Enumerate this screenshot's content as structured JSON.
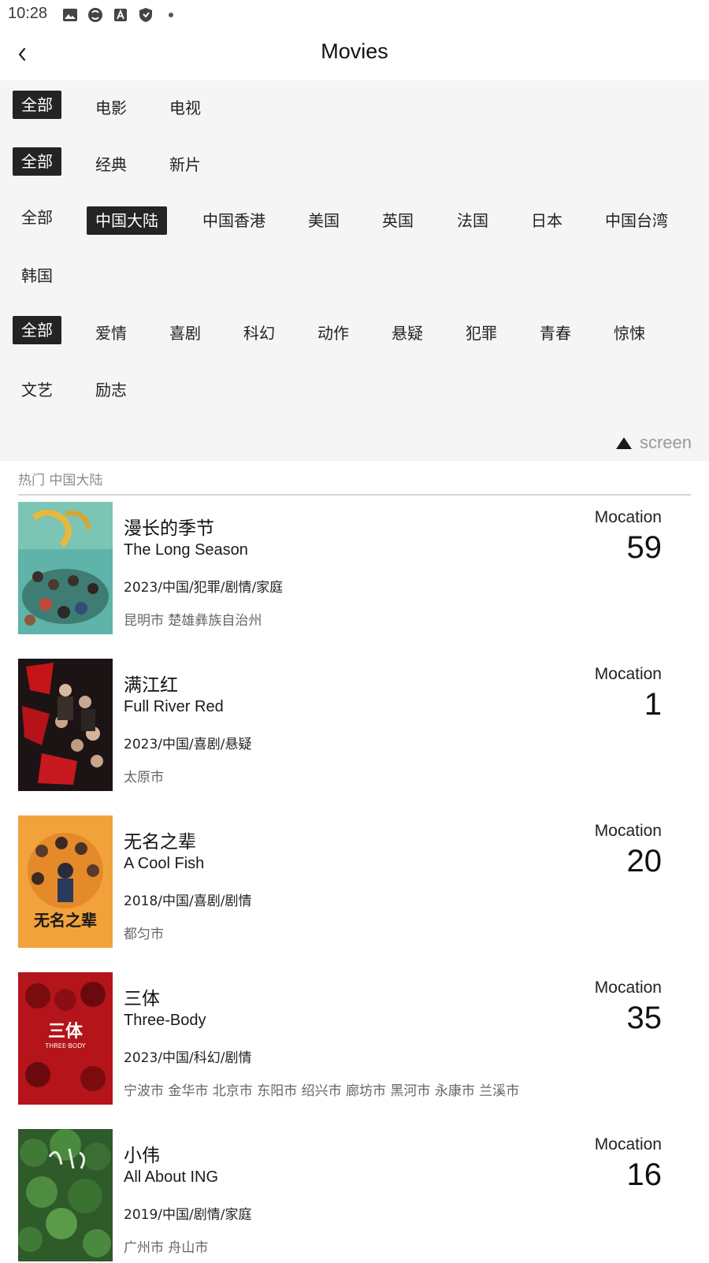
{
  "status_bar": {
    "time": "10:28"
  },
  "header": {
    "title": "Movies"
  },
  "filters": {
    "type": [
      "全部",
      "电影",
      "电视"
    ],
    "era": [
      "全部",
      "经典",
      "新片"
    ],
    "region": [
      "全部",
      "中国大陆",
      "中国香港",
      "美国",
      "英国",
      "法国",
      "日本",
      "中国台湾",
      "韩国"
    ],
    "genre": [
      "全部",
      "爱情",
      "喜剧",
      "科幻",
      "动作",
      "悬疑",
      "犯罪",
      "青春",
      "惊悚",
      "文艺",
      "励志"
    ],
    "toggle_label": "screen"
  },
  "section": {
    "label": "热门 中国大陆"
  },
  "movies": [
    {
      "title_cn": "漫长的季节",
      "title_en": "The Long Season",
      "info": "2023/中国/犯罪/剧情/家庭",
      "cities": "昆明市 楚雄彝族自治州",
      "count_label": "Mocation",
      "count": "59"
    },
    {
      "title_cn": "满江红",
      "title_en": "Full River Red",
      "info": "2023/中国/喜剧/悬疑",
      "cities": "太原市",
      "count_label": "Mocation",
      "count": "1"
    },
    {
      "title_cn": "无名之辈",
      "title_en": "A Cool Fish",
      "info": "2018/中国/喜剧/剧情",
      "cities": "都匀市",
      "count_label": "Mocation",
      "count": "20"
    },
    {
      "title_cn": "三体",
      "title_en": "Three-Body",
      "info": "2023/中国/科幻/剧情",
      "cities": "宁波市 金华市 北京市 东阳市 绍兴市 廊坊市 黑河市 永康市 兰溪市",
      "count_label": "Mocation",
      "count": "35"
    },
    {
      "title_cn": "小伟",
      "title_en": "All About ING",
      "info": "2019/中国/剧情/家庭",
      "cities": "广州市 舟山市",
      "count_label": "Mocation",
      "count": "16"
    }
  ],
  "poster_text": {
    "m3": "无名之辈",
    "m4": "三体",
    "m4_sub": "THREE·BODY"
  }
}
